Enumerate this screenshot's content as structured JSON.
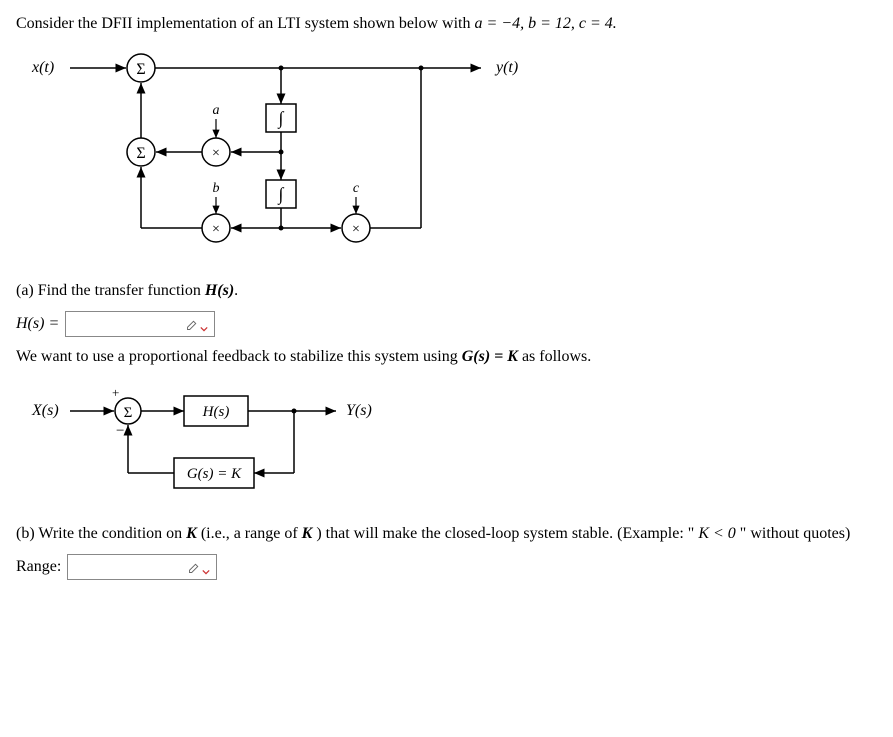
{
  "problem": {
    "intro_prefix": "Consider the DFII implementation of an LTI system shown below with ",
    "params_eq": "a = −4, b = 12, c = 4.",
    "a": -4,
    "b": 12,
    "c": 4
  },
  "diagram1": {
    "x_label": "x(t)",
    "y_label": "y(t)",
    "sum_symbol": "Σ",
    "mult_symbol": "×",
    "int_symbol": "∫",
    "a_label": "a",
    "b_label": "b",
    "c_label": "c"
  },
  "part_a": {
    "prompt": "(a) Find the transfer function ",
    "Hs_bold": "H(s)",
    "period": ".",
    "lhs": "H(s) ="
  },
  "feedback_text": {
    "line_prefix": "We want to use a proportional feedback to stabilize this system using ",
    "Gs_eq": "G(s) = K",
    "suffix": " as follows."
  },
  "diagram2": {
    "Xs": "X(s)",
    "Ys": "Y(s)",
    "Hs": "H(s)",
    "Gs": "G(s) = K",
    "sum": "Σ",
    "plus": "+",
    "minus": "−"
  },
  "part_b": {
    "prompt_prefix": "(b) Write the condition on ",
    "K1": "K",
    "mid": " (i.e., a range of ",
    "K2": "K",
    "suffix": ") that will make the closed-loop system stable. (Example: \"",
    "example": "K < 0",
    "end": "\" without quotes)",
    "range_label": "Range:"
  }
}
